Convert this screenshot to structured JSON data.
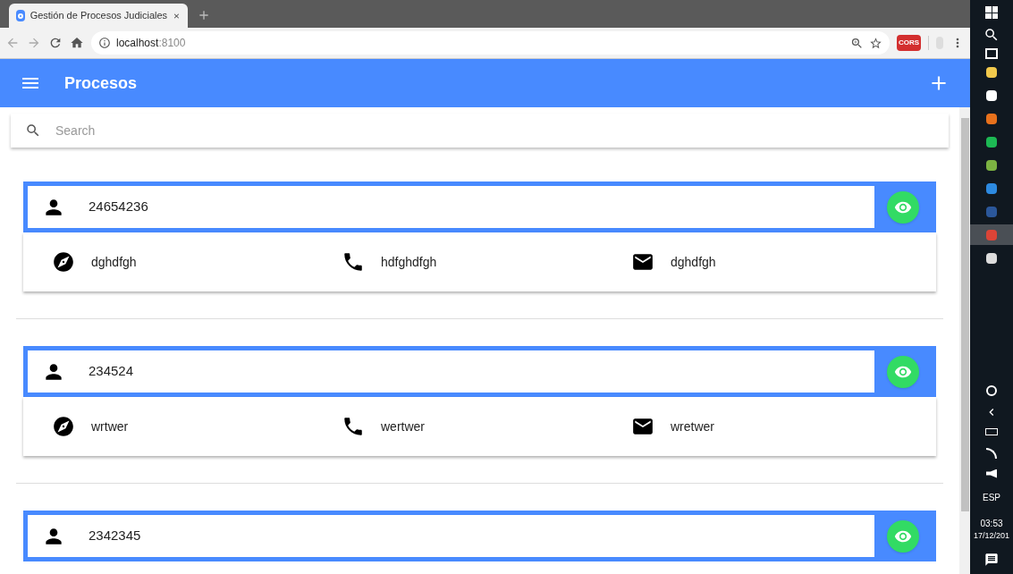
{
  "browser": {
    "tab_title": "Gestión de Procesos Judiciales",
    "url_host": "localhost",
    "url_port": ":8100",
    "extension_label": "CORS"
  },
  "app_bar": {
    "title": "Procesos"
  },
  "search": {
    "placeholder": "Search"
  },
  "processes": [
    {
      "id": "24654236",
      "address": "dghdfgh",
      "phone": "hdfghdfgh",
      "email": "dghdfgh"
    },
    {
      "id": "234524",
      "address": "wrtwer",
      "phone": "wertwer",
      "email": "wretwer"
    },
    {
      "id": "2342345"
    }
  ],
  "taskbar": {
    "apps": [
      {
        "selected": false
      },
      {
        "selected": false
      },
      {
        "selected": false
      },
      {
        "selected": false
      },
      {
        "selected": false
      },
      {
        "selected": false
      },
      {
        "selected": false
      },
      {
        "selected": true
      },
      {
        "selected": false
      }
    ],
    "language": "ESP",
    "time": "03:53",
    "date": "17/12/201"
  }
}
